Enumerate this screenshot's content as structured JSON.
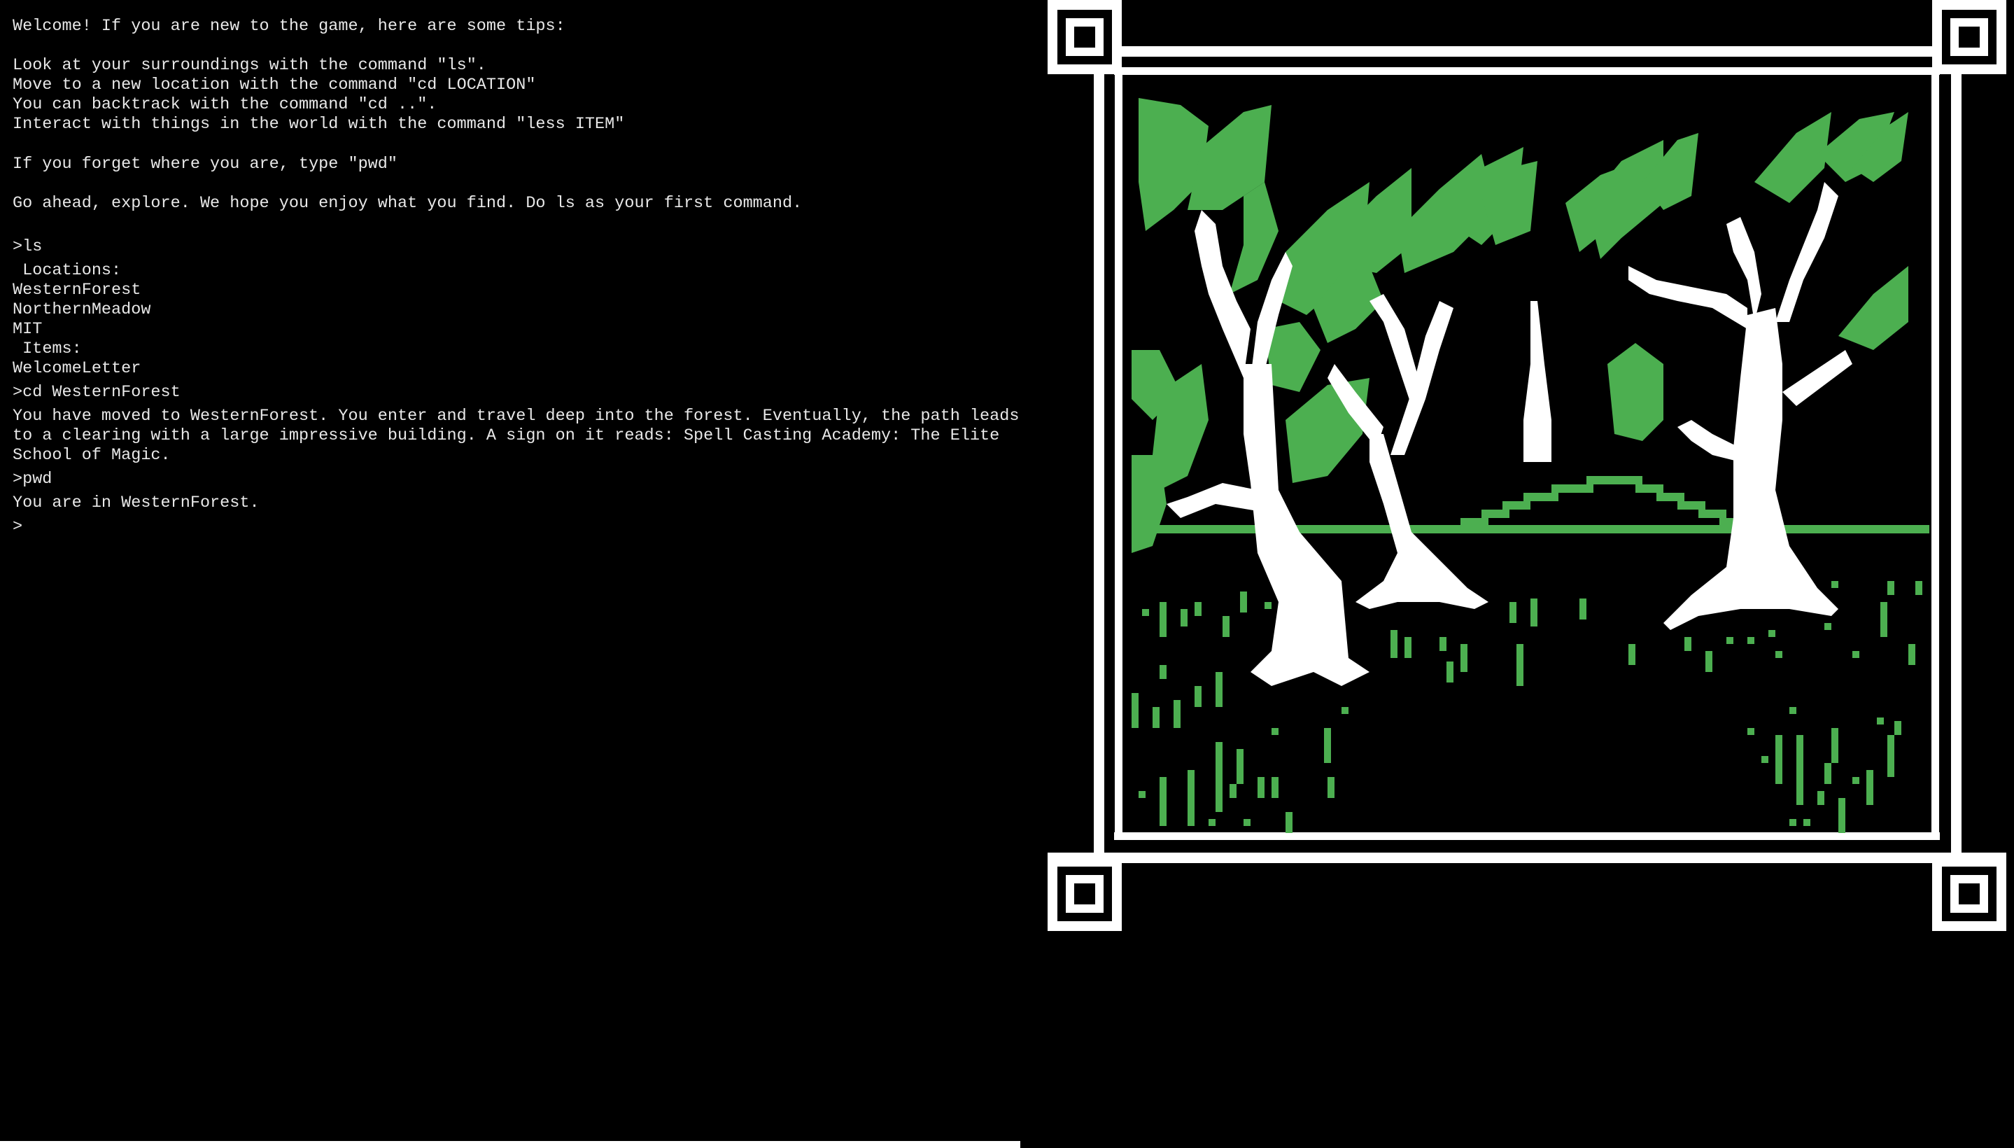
{
  "terminal": {
    "lines": [
      {
        "kind": "intro",
        "text": "Welcome! If you are new to the game, here are some tips:"
      },
      {
        "kind": "intro",
        "text": "Look at your surroundings with the command \"ls\"."
      },
      {
        "kind": "intro",
        "text": "Move to a new location with the command \"cd LOCATION\""
      },
      {
        "kind": "intro",
        "text": "You can backtrack with the command \"cd ..\"."
      },
      {
        "kind": "intro",
        "text": "Interact with things in the world with the command \"less ITEM\""
      },
      {
        "kind": "intro",
        "text": "If you forget where you are, type \"pwd\""
      },
      {
        "kind": "intro",
        "text": "Go ahead, explore. We hope you enjoy what you find. Do ls as your first command."
      },
      {
        "kind": "command",
        "text": ">ls"
      },
      {
        "kind": "output",
        "text": " Locations:"
      },
      {
        "kind": "output",
        "text": "WesternForest"
      },
      {
        "kind": "output",
        "text": "NorthernMeadow"
      },
      {
        "kind": "output",
        "text": "MIT"
      },
      {
        "kind": "output",
        "text": " Items:"
      },
      {
        "kind": "output",
        "text": "WelcomeLetter"
      },
      {
        "kind": "command",
        "text": ">cd WesternForest"
      },
      {
        "kind": "output",
        "text": "You have moved to WesternForest. You enter and travel deep into the forest. Eventually, the path leads to a clearing with a large impressive building. A sign on it reads: Spell Casting Academy: The Elite School of Magic."
      },
      {
        "kind": "command",
        "text": ">pwd"
      },
      {
        "kind": "output",
        "text": "You are in WesternForest."
      }
    ],
    "prompt": ">"
  },
  "colors": {
    "background": "#000000",
    "text": "#e8e8e8",
    "frame": "#ffffff",
    "foliage": "#4caf50",
    "trunk": "#ffffff"
  },
  "scene": {
    "icon": "forest-pixel-art"
  }
}
